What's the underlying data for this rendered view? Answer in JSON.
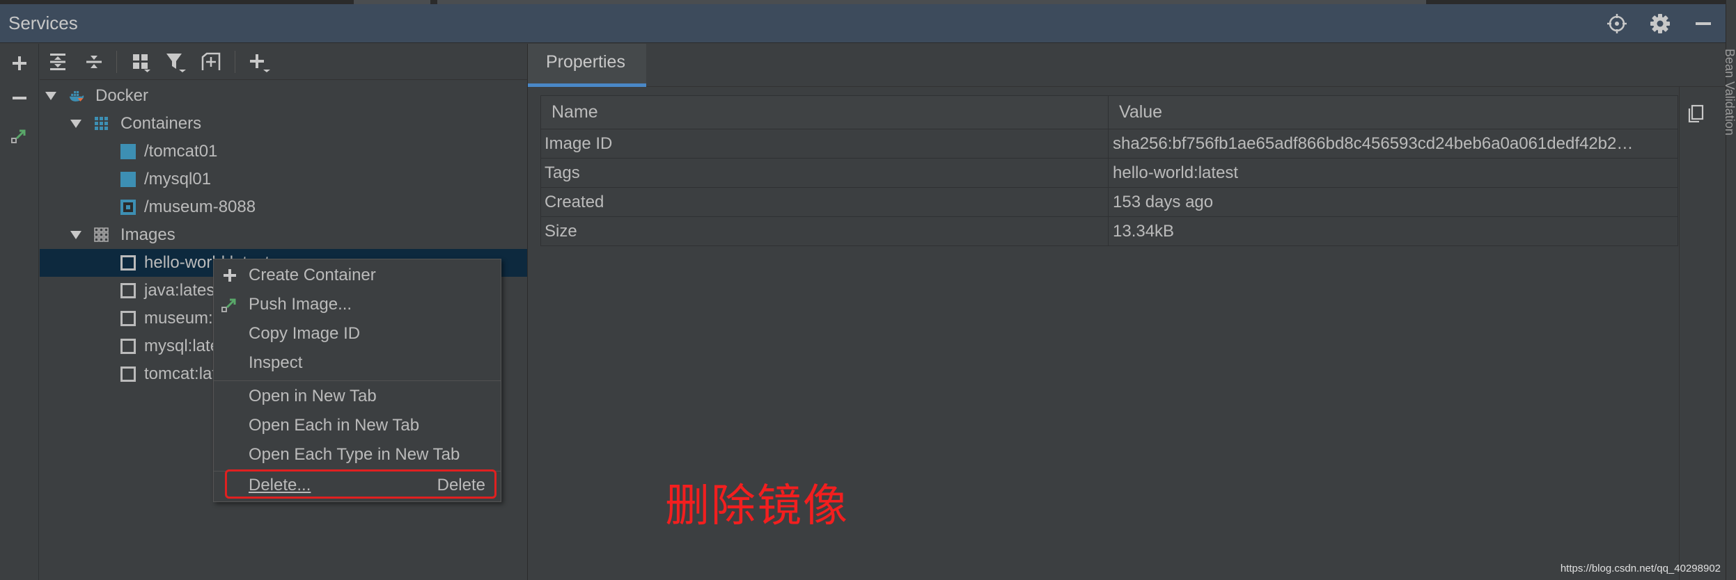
{
  "window": {
    "title": "Services"
  },
  "right_strip": {
    "label": "Bean Validation"
  },
  "title_actions": [
    {
      "name": "crosshair-icon"
    },
    {
      "name": "gear-icon"
    },
    {
      "name": "minimize-icon"
    }
  ],
  "left_toolbar": [
    {
      "name": "add-icon"
    },
    {
      "name": "remove-icon"
    },
    {
      "name": "deploy-icon"
    }
  ],
  "tree_toolbar": [
    {
      "name": "expand-all-icon"
    },
    {
      "name": "collapse-all-icon"
    },
    {
      "name": "group-by-icon"
    },
    {
      "name": "filter-icon"
    },
    {
      "name": "new-tab-icon"
    },
    {
      "name": "add-service-icon"
    }
  ],
  "tree": {
    "docker": {
      "label": "Docker"
    },
    "containers": {
      "label": "Containers",
      "items": [
        "/tomcat01",
        "/mysql01",
        "/museum-8088"
      ]
    },
    "images": {
      "label": "Images",
      "items": [
        "hello-world:latest",
        "java:latest",
        "museum:latest",
        "mysql:latest",
        "tomcat:latest"
      ]
    }
  },
  "properties": {
    "tab_label": "Properties",
    "columns": [
      "Name",
      "Value"
    ],
    "rows": [
      {
        "name": "Image ID",
        "value": "sha256:bf756fb1ae65adf866bd8c456593cd24beb6a0a061dedf42b2…"
      },
      {
        "name": "Tags",
        "value": "hello-world:latest"
      },
      {
        "name": "Created",
        "value": "153 days ago"
      },
      {
        "name": "Size",
        "value": "13.34kB"
      }
    ]
  },
  "context_menu": {
    "create_container": "Create Container",
    "push_image": "Push Image...",
    "copy_image_id": "Copy Image ID",
    "inspect": "Inspect",
    "open_in_new_tab": "Open in New Tab",
    "open_each_in_new_tab": "Open Each in New Tab",
    "open_each_type_in_new_tab": "Open Each Type in New Tab",
    "delete": "Delete...",
    "delete_shortcut": "Delete"
  },
  "annotation": "删除镜像",
  "watermark": "https://blog.csdn.net/qq_40298902",
  "colors": {
    "title_bar": "#3d4b5c",
    "selection": "#0d293e",
    "tab_underline": "#4a88c7",
    "annotation": "#f21f1f",
    "container_icon": "#3d8fb3",
    "deploy_green": "#59a869"
  }
}
